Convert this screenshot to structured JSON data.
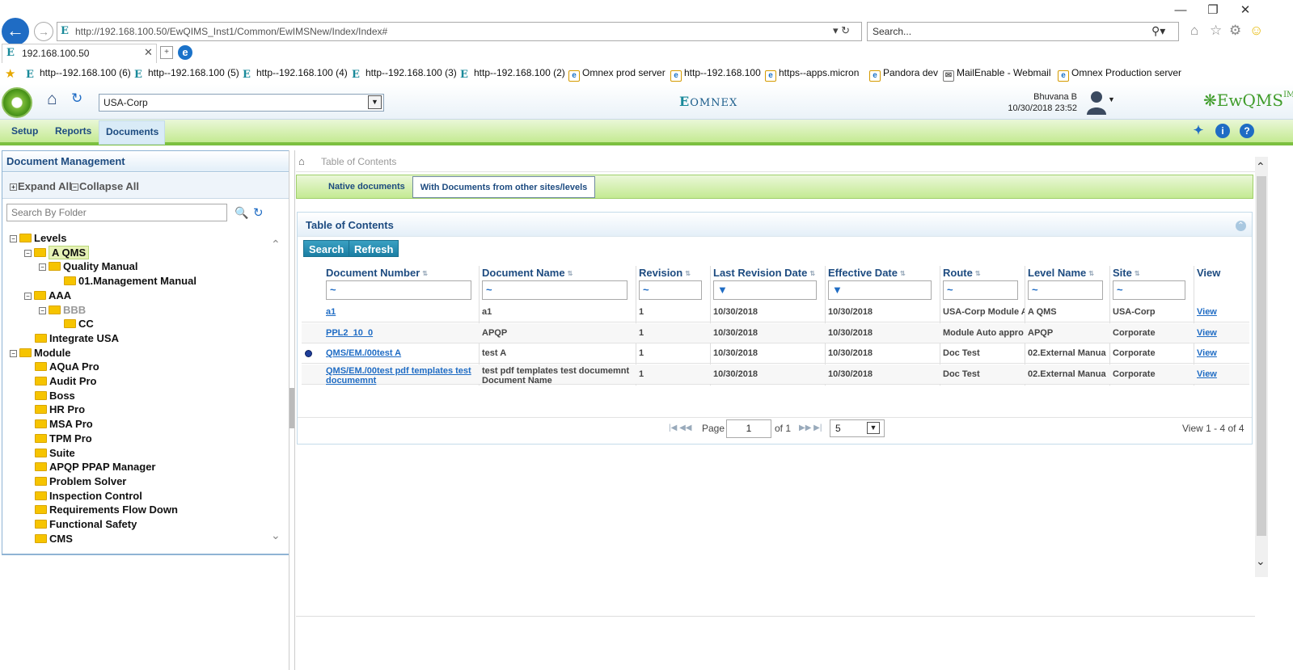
{
  "browser": {
    "window_controls": {
      "minimize": "—",
      "restore": "❐",
      "close": "✕"
    },
    "address": "http://192.168.100.50/EwQIMS_Inst1/Common/EwIMSNew/Index/Index#",
    "address_host": "192.168.100.50",
    "search_placeholder": "Search...",
    "tab_title": "192.168.100.50",
    "favorites": [
      "http--192.168.100 (6)",
      "http--192.168.100 (5)",
      "http--192.168.100 (4)",
      "http--192.168.100 (3)",
      "http--192.168.100 (2)",
      "Omnex prod server",
      "http--192.168.100",
      "https--apps.micron",
      "Pandora dev",
      "MailEnable - Webmail",
      "Omnex Production server"
    ]
  },
  "app": {
    "site_select": "USA-Corp",
    "center_logo": "OMNEX",
    "brand_logo": "EwQMS",
    "brand_logo_sup": "IMS",
    "user_name": "Bhuvana B",
    "user_datetime": "10/30/2018 23:52",
    "menu": [
      "Setup",
      "Reports",
      "Documents"
    ],
    "accent_color": "#7cc040",
    "header_icons": [
      "pin-icon",
      "info-icon",
      "help-icon"
    ]
  },
  "left_panel": {
    "title": "Document Management",
    "expand_all": "Expand All",
    "collapse_all": "Collapse All",
    "search_placeholder": "Search By Folder",
    "tree": [
      {
        "label": "Levels",
        "level": 0,
        "toggle": "⊟"
      },
      {
        "label": "A QMS",
        "level": 1,
        "toggle": "⊟",
        "selected": true
      },
      {
        "label": "Quality Manual",
        "level": 2,
        "toggle": "⊟"
      },
      {
        "label": "01.Management Manual",
        "level": 3
      },
      {
        "label": "AAA",
        "level": 1,
        "toggle": "⊟"
      },
      {
        "label": "BBB",
        "level": 2,
        "toggle": "⊟",
        "disabled": true
      },
      {
        "label": "CC",
        "level": 3
      },
      {
        "label": "Integrate USA",
        "level": 1
      },
      {
        "label": "Module",
        "level": 0,
        "toggle": "⊟"
      },
      {
        "label": "AQuA Pro",
        "level": 1
      },
      {
        "label": "Audit Pro",
        "level": 1
      },
      {
        "label": "Boss",
        "level": 1
      },
      {
        "label": "HR Pro",
        "level": 1
      },
      {
        "label": "MSA Pro",
        "level": 1
      },
      {
        "label": "TPM Pro",
        "level": 1
      },
      {
        "label": "Suite",
        "level": 1
      },
      {
        "label": "APQP PPAP Manager",
        "level": 1
      },
      {
        "label": "Problem Solver",
        "level": 1
      },
      {
        "label": "Inspection Control",
        "level": 1
      },
      {
        "label": "Requirements Flow Down",
        "level": 1
      },
      {
        "label": "Functional Safety",
        "level": 1
      },
      {
        "label": "CMS",
        "level": 1
      }
    ]
  },
  "main": {
    "breadcrumb": "Table of Contents",
    "tabs": [
      "Native documents",
      "With Documents from other sites/levels"
    ],
    "active_tab": 1,
    "panel_title": "Table of Contents",
    "buttons": {
      "search": "Search",
      "refresh": "Refresh"
    },
    "columns": [
      "Document Number",
      "Document Name",
      "Revision",
      "Last Revision Date",
      "Effective Date",
      "Route",
      "Level Name",
      "Site",
      "View"
    ],
    "filter_symbols": [
      "~",
      "~",
      "~",
      "▼",
      "▼",
      "~",
      "~",
      "~"
    ],
    "rows": [
      {
        "doc_number": "a1",
        "doc_name": "a1",
        "revision": "1",
        "last_rev": "10/30/2018",
        "effective": "10/30/2018",
        "route": "USA-Corp Module A",
        "level": "A QMS",
        "site": "USA-Corp",
        "view": "View",
        "marker": false
      },
      {
        "doc_number": "PPL2_10_0",
        "doc_name": "APQP",
        "revision": "1",
        "last_rev": "10/30/2018",
        "effective": "10/30/2018",
        "route": "Module Auto appro",
        "level": "APQP",
        "site": "Corporate",
        "view": "View",
        "marker": false
      },
      {
        "doc_number": "QMS/EM./00test A",
        "doc_name": "test A",
        "revision": "1",
        "last_rev": "10/30/2018",
        "effective": "10/30/2018",
        "route": "Doc Test",
        "level": "02.External Manua",
        "site": "Corporate",
        "view": "View",
        "marker": true
      },
      {
        "doc_number": "QMS/EM./00test pdf templates test documemnt",
        "doc_name": "test pdf templates test documemnt Document Name",
        "revision": "1",
        "last_rev": "10/30/2018",
        "effective": "10/30/2018",
        "route": "Doc Test",
        "level": "02.External Manua",
        "site": "Corporate",
        "view": "View",
        "marker": false
      }
    ],
    "pager": {
      "page_label": "Page",
      "page": "1",
      "of": "of 1",
      "page_size": "5",
      "view_text": "View 1 - 4 of 4"
    }
  }
}
